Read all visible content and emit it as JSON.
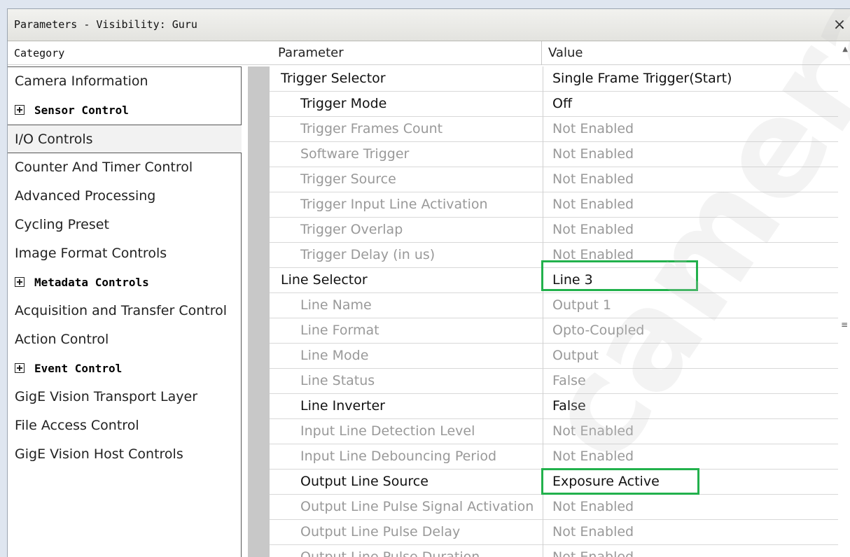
{
  "window": {
    "title": "Parameters - Visibility: Guru",
    "close_glyph": "×"
  },
  "columns": {
    "category": "Category",
    "parameter": "Parameter",
    "value": "Value"
  },
  "categories": [
    {
      "label": "Camera Information",
      "group": false,
      "selected": false
    },
    {
      "label": "Sensor Control",
      "group": true,
      "selected": false
    },
    {
      "label": "I/O Controls",
      "group": false,
      "selected": true
    },
    {
      "label": "Counter And Timer Control",
      "group": false,
      "selected": false
    },
    {
      "label": "Advanced Processing",
      "group": false,
      "selected": false
    },
    {
      "label": "Cycling Preset",
      "group": false,
      "selected": false
    },
    {
      "label": "Image Format Controls",
      "group": false,
      "selected": false
    },
    {
      "label": "Metadata Controls",
      "group": true,
      "selected": false
    },
    {
      "label": "Acquisition and Transfer Control",
      "group": false,
      "selected": false
    },
    {
      "label": "Action Control",
      "group": false,
      "selected": false
    },
    {
      "label": "Event Control",
      "group": true,
      "selected": false
    },
    {
      "label": "GigE Vision Transport Layer",
      "group": false,
      "selected": false
    },
    {
      "label": "File Access Control",
      "group": false,
      "selected": false
    },
    {
      "label": "GigE Vision Host Controls",
      "group": false,
      "selected": false
    }
  ],
  "parameters": [
    {
      "name": "Trigger Selector",
      "value": "Single Frame Trigger(Start)",
      "level": "top",
      "active": true
    },
    {
      "name": "Trigger Mode",
      "value": "Off",
      "level": "child",
      "active": true
    },
    {
      "name": "Trigger Frames Count",
      "value": "Not Enabled",
      "level": "child",
      "active": false
    },
    {
      "name": "Software Trigger",
      "value": "Not Enabled",
      "level": "child",
      "active": false
    },
    {
      "name": "Trigger Source",
      "value": "Not Enabled",
      "level": "child",
      "active": false
    },
    {
      "name": "Trigger Input Line Activation",
      "value": "Not Enabled",
      "level": "child",
      "active": false
    },
    {
      "name": "Trigger Overlap",
      "value": "Not Enabled",
      "level": "child",
      "active": false
    },
    {
      "name": "Trigger Delay (in us)",
      "value": "Not Enabled",
      "level": "child",
      "active": false
    },
    {
      "name": "Line Selector",
      "value": "Line 3",
      "level": "top",
      "active": true,
      "highlighted": true
    },
    {
      "name": "Line Name",
      "value": "Output 1",
      "level": "child",
      "active": false
    },
    {
      "name": "Line Format",
      "value": "Opto-Coupled",
      "level": "child",
      "active": false
    },
    {
      "name": "Line Mode",
      "value": "Output",
      "level": "child",
      "active": false
    },
    {
      "name": "Line Status",
      "value": "False",
      "level": "child",
      "active": false
    },
    {
      "name": "Line Inverter",
      "value": "False",
      "level": "child",
      "active": true
    },
    {
      "name": "Input Line Detection Level",
      "value": "Not Enabled",
      "level": "child",
      "active": false
    },
    {
      "name": "Input Line Debouncing Period",
      "value": "Not Enabled",
      "level": "child",
      "active": false
    },
    {
      "name": "Output Line Source",
      "value": "Exposure Active",
      "level": "child",
      "active": true,
      "highlighted": true
    },
    {
      "name": "Output Line Pulse Signal Activation",
      "value": "Not Enabled",
      "level": "child",
      "active": false
    },
    {
      "name": "Output Line Pulse Delay",
      "value": "Not Enabled",
      "level": "child",
      "active": false
    },
    {
      "name": "Output Line Pulse Duration",
      "value": "Not Enabled",
      "level": "child",
      "active": false
    }
  ],
  "highlight_color": "#22b14c",
  "watermark": "camera"
}
